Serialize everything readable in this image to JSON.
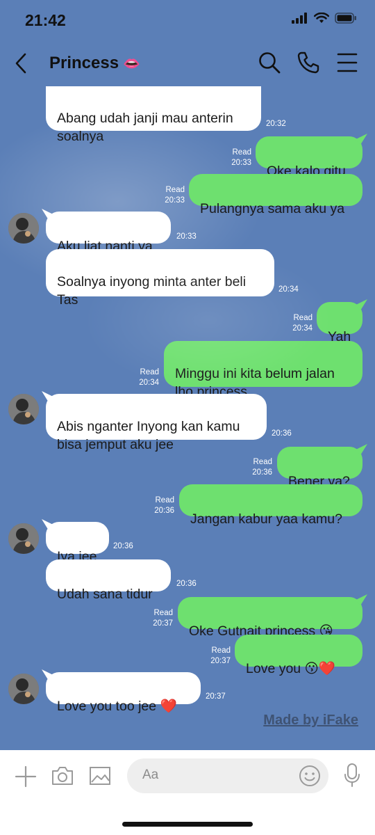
{
  "status": {
    "time": "21:42"
  },
  "header": {
    "title": "Princess",
    "title_emoji": "👄"
  },
  "messages": [
    {
      "dir": "in",
      "text": "Abang udah janji mau anterin soalnya",
      "time": "20:32",
      "read": ""
    },
    {
      "dir": "out",
      "text": "Oke kalo gitu",
      "time": "20:33",
      "read": "Read"
    },
    {
      "dir": "out",
      "text": "Pulangnya sama aku ya",
      "time": "20:33",
      "read": "Read"
    },
    {
      "dir": "in",
      "text": "Aku liat nanti ya",
      "time": "20:33",
      "read": ""
    },
    {
      "dir": "in",
      "text": "Soalnya inyong minta anter beli Tas",
      "time": "20:34",
      "read": ""
    },
    {
      "dir": "out",
      "text": "Yah",
      "time": "20:34",
      "read": "Read"
    },
    {
      "dir": "out",
      "text": "Minggu ini kita belum jalan lho princess",
      "time": "20:34",
      "read": "Read"
    },
    {
      "dir": "in",
      "text": "Abis nganter Inyong kan kamu bisa jemput aku jee",
      "time": "20:36",
      "read": ""
    },
    {
      "dir": "out",
      "text": "Bener ya?",
      "time": "20:36",
      "read": "Read"
    },
    {
      "dir": "out",
      "text": "Jangan kabur yaa kamu?",
      "time": "20:36",
      "read": "Read"
    },
    {
      "dir": "in",
      "text": "Iya jee",
      "time": "20:36",
      "read": ""
    },
    {
      "dir": "in",
      "text": "Udah sana tidur",
      "time": "20:36",
      "read": ""
    },
    {
      "dir": "out",
      "text": "Oke Gutnait princess 😘",
      "time": "20:37",
      "read": "Read"
    },
    {
      "dir": "out",
      "text": "Love you 😗❤️",
      "time": "20:37",
      "read": "Read"
    },
    {
      "dir": "in",
      "text": "Love you too jee ❤️",
      "time": "20:37",
      "read": ""
    }
  ],
  "watermark": "Made by iFake",
  "composer": {
    "placeholder": "Aa",
    "icons": [
      "plus-icon",
      "camera-icon",
      "image-icon",
      "emoji-icon",
      "microphone-icon"
    ]
  },
  "colors": {
    "background": "#5b7fb7",
    "outgoing": "#6ee06f",
    "incoming": "#ffffff"
  }
}
